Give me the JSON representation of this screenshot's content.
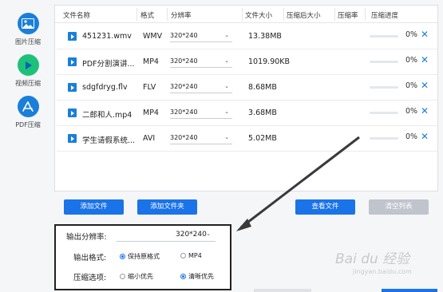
{
  "sidebar": {
    "items": [
      {
        "label": "图片压缩",
        "icon": "image-icon"
      },
      {
        "label": "视频压缩",
        "icon": "video-play-icon"
      },
      {
        "label": "PDF压缩",
        "icon": "pdf-icon"
      }
    ]
  },
  "table": {
    "headers": [
      "文件名称",
      "格式",
      "分辨率",
      "文件大小",
      "压缩后大小",
      "压缩率",
      "压缩进度"
    ],
    "rows": [
      {
        "name": "451231.wmv",
        "format": "WMV",
        "resolution": "320*240",
        "size": "13.38MB",
        "after": "",
        "ratio": "",
        "progress": "0%",
        "progress_value": 0
      },
      {
        "name": "PDF分割演讲...",
        "format": "MP4",
        "resolution": "320*240",
        "size": "1019.90KB",
        "after": "",
        "ratio": "",
        "progress": "0%",
        "progress_value": 0
      },
      {
        "name": "sdgfdryg.flv",
        "format": "FLV",
        "resolution": "320*240",
        "size": "8.68MB",
        "after": "",
        "ratio": "",
        "progress": "0%",
        "progress_value": 0
      },
      {
        "name": "二郎和人.mp4",
        "format": "MP4",
        "resolution": "320*240",
        "size": "3.68MB",
        "after": "",
        "ratio": "",
        "progress": "0%",
        "progress_value": 0
      },
      {
        "name": "学生请假系统...",
        "format": "AVI",
        "resolution": "320*240",
        "size": "5.02MB",
        "after": "",
        "ratio": "",
        "progress": "0%",
        "progress_value": 0
      }
    ],
    "delete_icon": "close-icon",
    "dropdown_icon": "chevron-down-icon"
  },
  "toolbar": {
    "add_file": "添加文件",
    "add_folder": "添加文件夹",
    "view_files": "查看文件",
    "clear_list": "清空列表"
  },
  "settings": {
    "resolution_label": "输出分辨率:",
    "resolution_value": "320*240",
    "format_label": "输出格式:",
    "format_options": [
      "保持原格式",
      "MP4"
    ],
    "format_selected": "保持原格式",
    "compress_label": "压缩选项:",
    "compress_options": [
      "缩小优先",
      "清晰优先"
    ],
    "compress_selected": "清晰优先"
  },
  "watermark": {
    "text": "Bai du 经验",
    "sub": "jingyan.baidu.com"
  },
  "colors": {
    "accent": "#1a73e8",
    "icon_blue": "#1a7fd9",
    "green": "#1ec17a",
    "disabled": "#c0c4cc"
  }
}
